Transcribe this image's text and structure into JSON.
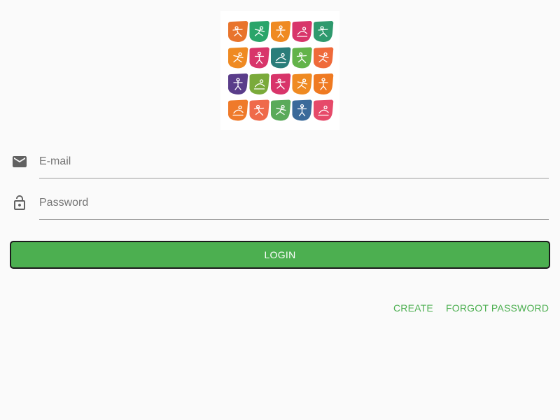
{
  "logo": {
    "icon": "sports-pictograms-logo",
    "tile_colors": [
      [
        "#e8742c",
        "#2aa56a",
        "#ef8a22",
        "#d8356a",
        "#2f9a6e"
      ],
      [
        "#ef8a22",
        "#d8356a",
        "#2a7d7a",
        "#63b34a",
        "#ef6a3a"
      ],
      [
        "#5a3d8a",
        "#7aaa3a",
        "#d8356a",
        "#ef8a22",
        "#ef7a22"
      ],
      [
        "#ef7a2a",
        "#ef6a4a",
        "#5aaa5a",
        "#3a6a9a",
        "#e64a6a"
      ]
    ]
  },
  "email": {
    "icon": "mail-icon",
    "placeholder": "E-mail",
    "value": ""
  },
  "password": {
    "icon": "lock-icon",
    "placeholder": "Password",
    "value": ""
  },
  "actions": {
    "login_label": "LOGIN",
    "create_label": "CREATE",
    "forgot_label": "FORGOT PASSWORD"
  },
  "colors": {
    "accent": "#4caf50",
    "background": "#fafafa",
    "icon": "#616161"
  }
}
